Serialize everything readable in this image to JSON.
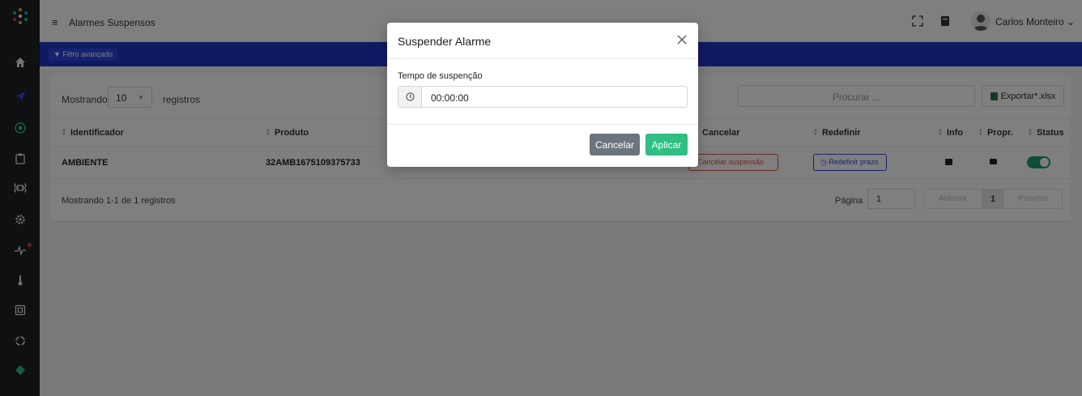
{
  "header": {
    "title": "Alarmes Suspensos",
    "user_name": "Carlos Monteiro",
    "user_caret": "⌄"
  },
  "toolbar": {
    "filter_label": "Filtro avançado"
  },
  "table_controls": {
    "show_label": "Mostrando",
    "page_size": "10",
    "records_label": "registros",
    "search_placeholder": "Procurar ...",
    "export_label": "Exportar*.xlsx"
  },
  "table": {
    "columns": {
      "identifier": "Identificador",
      "product": "Produto",
      "cancel": "Cancelar",
      "redefine": "Redefinir",
      "info": "Info",
      "props": "Propr.",
      "status": "Status"
    },
    "rows": [
      {
        "identifier": "AMBIENTE",
        "product": "32AMB1675109375733",
        "cancel_btn": "Cancelar suspensão",
        "redefine_btn": "Redefinir prazo",
        "status_on": true
      }
    ]
  },
  "footer": {
    "summary": "Mostrando 1-1 de 1 registros",
    "page_label": "Página",
    "page_value": "1",
    "prev": "Anterior",
    "current": "1",
    "next": "Próxima"
  },
  "modal": {
    "title": "Suspender Alarme",
    "field_label": "Tempo de suspenção",
    "time_value": "00:00:00",
    "cancel_label": "Cancelar",
    "apply_label": "Aplicar"
  },
  "colors": {
    "sidebar": "#1c2024",
    "blue_bar": "#2035c5",
    "toggle_on": "#1e9b6b",
    "apply_button": "#2fbf82",
    "cancel_button": "#6c757d",
    "danger": "#d9534f"
  },
  "icons": [
    "app-logo-icon",
    "home-icon",
    "send-icon",
    "target-icon",
    "clipboard-icon",
    "command-icon",
    "cog-icon",
    "pulse-icon",
    "thermometer-icon",
    "chip-icon",
    "loader-icon",
    "diamond-icon",
    "fullscreen-icon",
    "book-icon",
    "clock-icon",
    "close-icon",
    "excel-icon"
  ]
}
